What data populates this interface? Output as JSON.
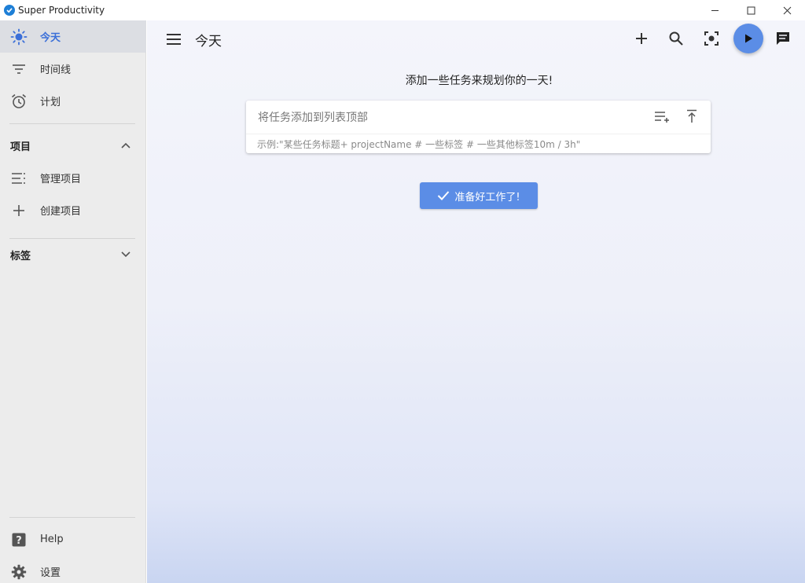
{
  "window": {
    "title": "Super Productivity"
  },
  "sidebar": {
    "nav": [
      {
        "label": "今天",
        "icon": "sun-icon"
      },
      {
        "label": "时间线",
        "icon": "timeline-icon"
      },
      {
        "label": "计划",
        "icon": "alarm-clock-icon"
      }
    ],
    "projects": {
      "heading": "项目",
      "items": [
        {
          "label": "管理项目",
          "icon": "manage-list-icon"
        },
        {
          "label": "创建项目",
          "icon": "plus-icon"
        }
      ]
    },
    "tags": {
      "heading": "标签"
    },
    "footer": [
      {
        "label": "Help",
        "icon": "help-icon"
      },
      {
        "label": "设置",
        "icon": "gear-icon"
      }
    ]
  },
  "main": {
    "title": "今天",
    "headline": "添加一些任务来规划你的一天!",
    "add_task": {
      "placeholder": "将任务添加到列表顶部",
      "hint": "示例:\"某些任务标题+ projectName # 一些标签 # 一些其他标签10m / 3h\""
    },
    "ready_button": "准备好工作了!"
  },
  "colors": {
    "accent": "#5b8de6",
    "active_nav_text": "#3b6fd8",
    "sidebar_bg": "#ececec"
  }
}
